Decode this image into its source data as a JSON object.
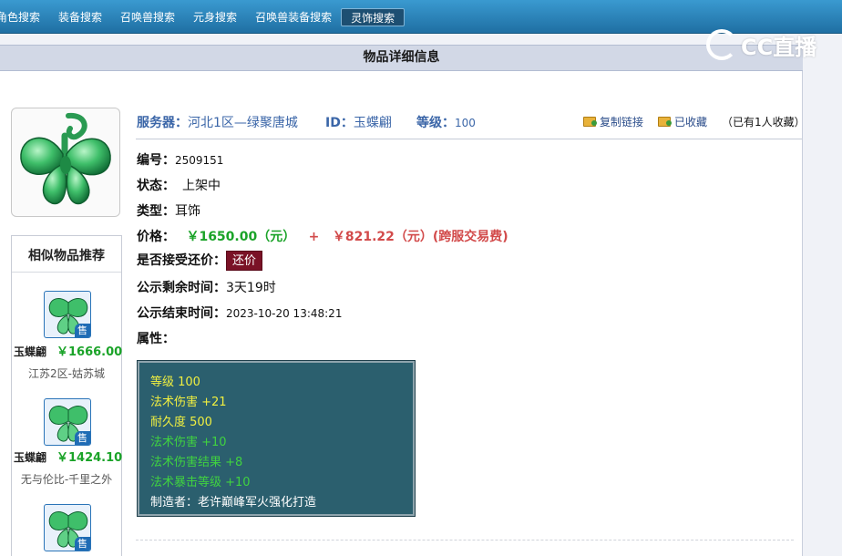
{
  "nav": {
    "tabs": [
      "角色搜索",
      "装备搜索",
      "召唤兽搜索",
      "元身搜索",
      "召唤兽装备搜索",
      "灵饰搜索"
    ],
    "active_index": 5,
    "watermark": "CC直播"
  },
  "title": "物品详细信息",
  "header": {
    "server_label": "服务器：",
    "server_value": "河北1区—绿聚唐城",
    "id_label": "ID：",
    "id_value": "玉蝶翩",
    "level_label": "等级：",
    "level_value": "100",
    "copy_link": "复制链接",
    "favorited": "已收藏",
    "fav_count": "（已有1人收藏）"
  },
  "details": {
    "number_label": "编号：",
    "number_value": "2509151",
    "status_label": "状态：",
    "status_value": "上架中",
    "type_label": "类型：",
    "type_value": "耳饰",
    "price_label": "价格：",
    "price_value": "￥1650.00（元）",
    "plus": "+",
    "fee_value": "￥821.22（元）(跨服交易费)",
    "bargain_label": "是否接受还价：",
    "bargain_button": "还价",
    "remaining_label": "公示剩余时间：",
    "remaining_value": "3天19时",
    "end_label": "公示结束时间：",
    "end_value": "2023-10-20 13:48:21",
    "attr_label": "属性："
  },
  "attributes": [
    {
      "text": "等级 100",
      "color": "#f0ef40"
    },
    {
      "text": "法术伤害 +21",
      "color": "#f0ef40"
    },
    {
      "text": "耐久度 500",
      "color": "#f0ef40"
    },
    {
      "text": "法术伤害 +10",
      "color": "#40d240"
    },
    {
      "text": "法术伤害结果 +8",
      "color": "#40d240"
    },
    {
      "text": "法术暴击等级 +10",
      "color": "#40d240"
    },
    {
      "text": "制造者：老许巅峰军火强化打造",
      "color": "#ffffff"
    }
  ],
  "similar": {
    "title": "相似物品推荐",
    "badge": "售",
    "items": [
      {
        "name": "玉蝶翩",
        "price": "￥1666.00",
        "server": "江苏2区-姑苏城"
      },
      {
        "name": "玉蝶翩",
        "price": "￥1424.10",
        "server": "无与伦比-千里之外"
      },
      {
        "name": "",
        "price": "",
        "server": ""
      }
    ]
  },
  "colors": {
    "nav_blue": "#1f6fa3",
    "header_blue": "#3b66a8",
    "price_green": "#1aa328",
    "fee_red": "#d24a4a",
    "bargain_bg": "#7a1226",
    "attr_bg": "#2b5f6e"
  }
}
